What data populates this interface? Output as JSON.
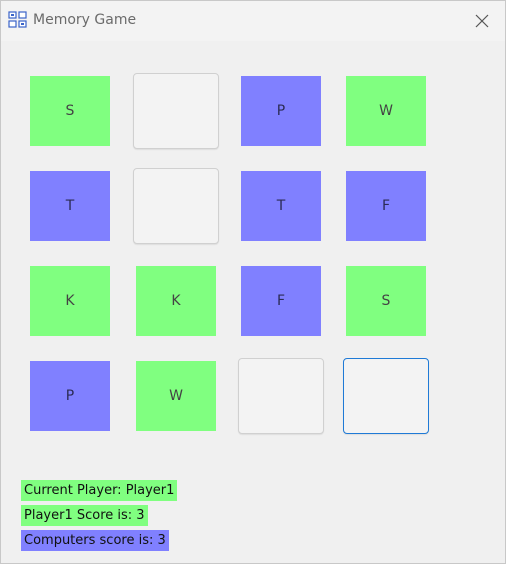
{
  "window": {
    "title": "Memory Game",
    "icon": "memory-game-app-icon",
    "close_icon": "close-icon"
  },
  "colors": {
    "green": "#80ff80",
    "blue": "#8080ff",
    "focus": "#1f7ad6"
  },
  "board": [
    [
      {
        "label": "S",
        "state": "green"
      },
      {
        "label": "",
        "state": "empty"
      },
      {
        "label": "P",
        "state": "blue"
      },
      {
        "label": "W",
        "state": "green"
      }
    ],
    [
      {
        "label": "T",
        "state": "blue"
      },
      {
        "label": "",
        "state": "empty"
      },
      {
        "label": "T",
        "state": "blue"
      },
      {
        "label": "F",
        "state": "blue"
      }
    ],
    [
      {
        "label": "K",
        "state": "green"
      },
      {
        "label": "K",
        "state": "green"
      },
      {
        "label": "F",
        "state": "blue"
      },
      {
        "label": "S",
        "state": "green"
      }
    ],
    [
      {
        "label": "P",
        "state": "blue"
      },
      {
        "label": "W",
        "state": "green"
      },
      {
        "label": "",
        "state": "empty"
      },
      {
        "label": "",
        "state": "empty-focused"
      }
    ]
  ],
  "status": {
    "current_player": "Current Player: Player1",
    "player_score": "Player1 Score is: 3",
    "computer_score": "Computers score is: 3"
  }
}
